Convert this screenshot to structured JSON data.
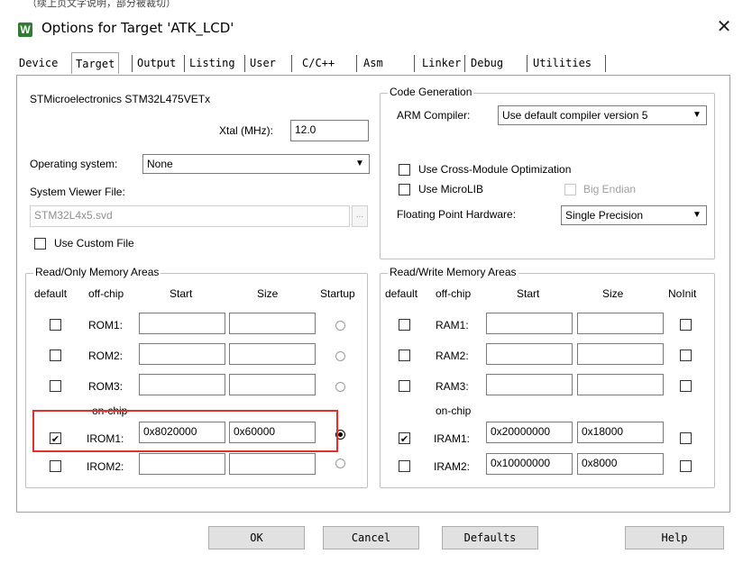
{
  "window": {
    "title": "Options for Target 'ATK_LCD'",
    "top_snippet": "（续上页文字说明，部分被裁切）"
  },
  "tabs": [
    {
      "label": "Device"
    },
    {
      "label": "Target"
    },
    {
      "label": "Output"
    },
    {
      "label": "Listing"
    },
    {
      "label": "User"
    },
    {
      "label": "C/C++"
    },
    {
      "label": "Asm"
    },
    {
      "label": "Linker"
    },
    {
      "label": "Debug"
    },
    {
      "label": "Utilities"
    }
  ],
  "active_tab": "Target",
  "device": {
    "name": "STMicroelectronics STM32L475VETx",
    "xtal_label": "Xtal (MHz):",
    "xtal_value": "12.0"
  },
  "os": {
    "label": "Operating system:",
    "value": "None"
  },
  "svd": {
    "label": "System Viewer File:",
    "value": "STM32L4x5.svd",
    "browse": "..."
  },
  "custom_file": {
    "label": "Use Custom File",
    "checked": false
  },
  "codegen": {
    "legend": "Code Generation",
    "compiler_label": "ARM Compiler:",
    "compiler_value": "Use default compiler version 5",
    "cross_module": "Use Cross-Module Optimization",
    "microlib": "Use MicroLIB",
    "big_endian": "Big Endian",
    "fp_label": "Floating Point Hardware:",
    "fp_value": "Single Precision"
  },
  "rom": {
    "legend": "Read/Only Memory Areas",
    "headers": {
      "default": "default",
      "offchip": "off-chip",
      "start": "Start",
      "size": "Size",
      "startup": "Startup"
    },
    "onchip_label": "on-chip",
    "rows": [
      {
        "label": "ROM1:",
        "start": "",
        "size": ""
      },
      {
        "label": "ROM2:",
        "start": "",
        "size": ""
      },
      {
        "label": "ROM3:",
        "start": "",
        "size": ""
      },
      {
        "label": "IROM1:",
        "start": "0x8020000",
        "size": "0x60000",
        "default": true,
        "startup": true
      },
      {
        "label": "IROM2:",
        "start": "",
        "size": ""
      }
    ]
  },
  "ram": {
    "legend": "Read/Write Memory Areas",
    "headers": {
      "default": "default",
      "offchip": "off-chip",
      "start": "Start",
      "size": "Size",
      "noinit": "NoInit"
    },
    "onchip_label": "on-chip",
    "rows": [
      {
        "label": "RAM1:",
        "start": "",
        "size": ""
      },
      {
        "label": "RAM2:",
        "start": "",
        "size": ""
      },
      {
        "label": "RAM3:",
        "start": "",
        "size": ""
      },
      {
        "label": "IRAM1:",
        "start": "0x20000000",
        "size": "0x18000",
        "default": true
      },
      {
        "label": "IRAM2:",
        "start": "0x10000000",
        "size": "0x8000"
      }
    ]
  },
  "buttons": {
    "ok": "OK",
    "cancel": "Cancel",
    "defaults": "Defaults",
    "help": "Help"
  },
  "colors": {
    "highlight": "#e0302a",
    "icon": "#2e7d32"
  }
}
